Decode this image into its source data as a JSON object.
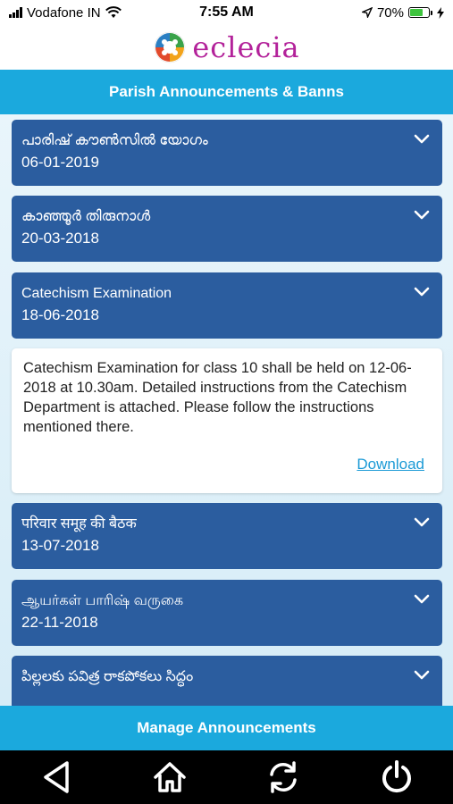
{
  "status_bar": {
    "carrier": "Vodafone IN",
    "time": "7:55 AM",
    "battery_percent": "70%",
    "battery_level": 0.7,
    "icons": [
      "signal-icon",
      "wifi-icon",
      "location-arrow-icon",
      "battery-icon",
      "charging-icon"
    ]
  },
  "app": {
    "name": "eclecia",
    "brand_color": "#b3229a",
    "logo_icon": "eclecia-logo-icon"
  },
  "header": {
    "title": "Parish Announcements & Banns",
    "color": "#1ba9dd"
  },
  "announcements": [
    {
      "title": "പാരിഷ് കൗൺസിൽ യോഗം",
      "date": "06-01-2019",
      "expanded": false
    },
    {
      "title": "കാഞ്ഞൂർ തിരുനാൾ",
      "date": "20-03-2018",
      "expanded": false
    },
    {
      "title": "Catechism Examination",
      "date": "18-06-2018",
      "expanded": true
    },
    {
      "title": "परिवार समूह की बैठक",
      "date": "13-07-2018",
      "expanded": false
    },
    {
      "title": "ஆயர்கள் பாரிஷ் வருகை",
      "date": "22-11-2018",
      "expanded": false
    },
    {
      "title": "పిల్లలకు పవిత్ర రాకపోకలు సిద్ధం",
      "date": "",
      "expanded": false
    }
  ],
  "detail": {
    "text": "Catechism Examination for class 10 shall be held on 12-06-2018 at 10.30am. Detailed instructions from the Catechism Department is attached. Please follow the instructions mentioned there.",
    "download_label": "Download",
    "link_color": "#1b9ad6"
  },
  "card_color": "#2b5d9f",
  "footer": {
    "button_label": "Manage Announcements"
  },
  "bottom_nav": {
    "items": [
      "back-triangle-icon",
      "home-icon",
      "refresh-icon",
      "power-icon"
    ]
  }
}
